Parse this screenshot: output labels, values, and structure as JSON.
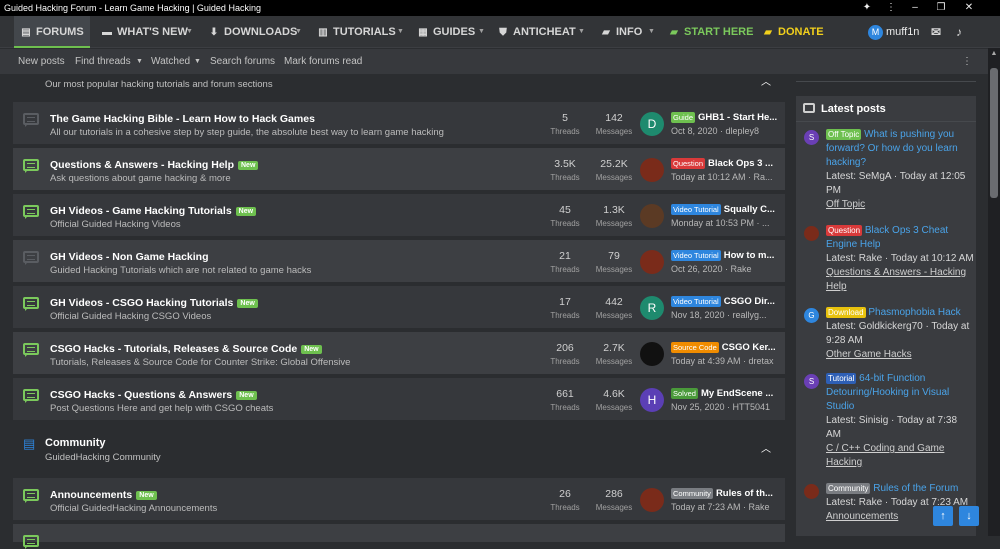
{
  "window": {
    "title": "Guided Hacking Forum - Learn Game Hacking | Guided Hacking"
  },
  "nav": {
    "items": [
      {
        "label": "FORUMS",
        "icon": "chat-icon"
      },
      {
        "label": "WHAT'S NEW",
        "icon": "comment-icon"
      },
      {
        "label": "DOWNLOADS",
        "icon": "download-icon"
      },
      {
        "label": "TUTORIALS",
        "icon": "book-icon"
      },
      {
        "label": "GUIDES",
        "icon": "guides-icon"
      },
      {
        "label": "ANTICHEAT",
        "icon": "shield-icon"
      },
      {
        "label": "INFO",
        "icon": "folder-icon"
      },
      {
        "label": "START HERE",
        "icon": "folder-icon"
      },
      {
        "label": "DONATE",
        "icon": "folder-icon"
      }
    ],
    "username": "muff1n",
    "user_initial": "M"
  },
  "subnav": [
    "New posts",
    "Find threads",
    "Watched",
    "Search forums",
    "Mark forums read"
  ],
  "category_top": {
    "desc": "Our most popular hacking tutorials and forum sections"
  },
  "nodes": [
    {
      "title": "The Game Hacking Bible - Learn How to Hack Games",
      "desc": "All our tutorials in a cohesive step by step guide, the absolute best way to learn game hacking",
      "isnew": false,
      "threads": "5",
      "messages": "142",
      "prefix": "Guide",
      "prefix_color": "#6ec04f",
      "last_title": "GHB1 - Start He...",
      "last_meta": "Oct 8, 2020 · dlepley8",
      "av_letter": "D",
      "av_color": "#1e8a6e"
    },
    {
      "title": "Questions & Answers - Hacking Help",
      "desc": "Ask questions about game hacking & more",
      "isnew": true,
      "threads": "3.5K",
      "messages": "25.2K",
      "prefix": "Question",
      "prefix_color": "#d93a3a",
      "last_title": "Black Ops 3 ...",
      "last_meta": "Today at 10:12 AM · Ra...",
      "av_letter": "",
      "av_color": "#7a2b1a"
    },
    {
      "title": "GH Videos - Game Hacking Tutorials",
      "desc": "Official Guided Hacking Videos",
      "isnew": true,
      "threads": "45",
      "messages": "1.3K",
      "prefix": "Video Tutorial",
      "prefix_color": "#2e86de",
      "last_title": "Squally C...",
      "last_meta": "Monday at 10:53 PM · ...",
      "av_letter": "",
      "av_color": "#5b3a24"
    },
    {
      "title": "GH Videos - Non Game Hacking",
      "desc": "Guided Hacking Tutorials which are not related to game hacks",
      "isnew": false,
      "threads": "21",
      "messages": "79",
      "prefix": "Video Tutorial",
      "prefix_color": "#2e86de",
      "last_title": "How to m...",
      "last_meta": "Oct 26, 2020 · Rake",
      "av_letter": "",
      "av_color": "#7a2b1a"
    },
    {
      "title": "GH Videos - CSGO Hacking Tutorials",
      "desc": "Official Guided Hacking CSGO Videos",
      "isnew": true,
      "threads": "17",
      "messages": "442",
      "prefix": "Video Tutorial",
      "prefix_color": "#2e86de",
      "last_title": "CSGO Dir...",
      "last_meta": "Nov 18, 2020 · reallyg...",
      "av_letter": "R",
      "av_color": "#1e8a6e"
    },
    {
      "title": "CSGO Hacks - Tutorials, Releases & Source Code",
      "desc": "Tutorials, Releases & Source Code for Counter Strike: Global Offensive",
      "isnew": true,
      "threads": "206",
      "messages": "2.7K",
      "prefix": "Source Code",
      "prefix_color": "#f08c00",
      "last_title": "CSGO Ker...",
      "last_meta": "Today at 4:39 AM · dretax",
      "av_letter": "",
      "av_color": "#111111"
    },
    {
      "title": "CSGO Hacks - Questions & Answers",
      "desc": "Post Questions Here and get help with CSGO cheats",
      "isnew": true,
      "threads": "661",
      "messages": "4.6K",
      "prefix": "Solved",
      "prefix_color": "#4a9a3a",
      "last_title": "My EndScene ...",
      "last_meta": "Nov 25, 2020 · HTT5041",
      "av_letter": "H",
      "av_color": "#5b3fb5"
    }
  ],
  "community": {
    "title": "Community",
    "desc": "GuidedHacking Community",
    "node": {
      "title": "Announcements",
      "desc": "Official GuidedHacking Announcements",
      "isnew": true,
      "threads": "26",
      "messages": "286",
      "prefix": "Community",
      "prefix_color": "#7a7d82",
      "last_title": "Rules of th...",
      "last_meta": "Today at 7:23 AM · Rake",
      "av_color": "#7a2b1a"
    }
  },
  "labels": {
    "threads": "Threads",
    "messages": "Messages",
    "new": "New"
  },
  "sidebar": {
    "title": "Latest posts",
    "items": [
      {
        "prefix": "Off Topic",
        "prefix_color": "#6ec04f",
        "thread": "What is pushing you forward? Or how do you learn hacking?",
        "meta": "Latest: SeMgA · Today at 12:05 PM",
        "forum": "Off Topic",
        "av_letter": "S",
        "av_color": "#6a3fb5"
      },
      {
        "prefix": "Question",
        "prefix_color": "#d93a3a",
        "thread": "Black Ops 3 Cheat Engine Help",
        "meta": "Latest: Rake · Today at 10:12 AM",
        "forum": "Questions & Answers - Hacking Help",
        "av_letter": "",
        "av_color": "#7a2b1a"
      },
      {
        "prefix": "Download",
        "prefix_color": "#e8c20e",
        "thread": "Phasmophobia Hack",
        "meta": "Latest: Goldkickerg70 · Today at 9:28 AM",
        "forum": "Other Game Hacks",
        "av_letter": "G",
        "av_color": "#2e86de"
      },
      {
        "prefix": "Tutorial",
        "prefix_color": "#2e5fb5",
        "thread": "64-bit Function Detouring/Hooking in Visual Studio",
        "meta": "Latest: Sinisig · Today at 7:38 AM",
        "forum": "C / C++ Coding and Game Hacking",
        "av_letter": "S",
        "av_color": "#6a3fb5"
      },
      {
        "prefix": "Community",
        "prefix_color": "#7a7d82",
        "thread": "Rules of the Forum",
        "meta": "Latest: Rake · Today at 7:23 AM",
        "forum": "Announcements",
        "av_letter": "",
        "av_color": "#7a2b1a"
      }
    ]
  }
}
